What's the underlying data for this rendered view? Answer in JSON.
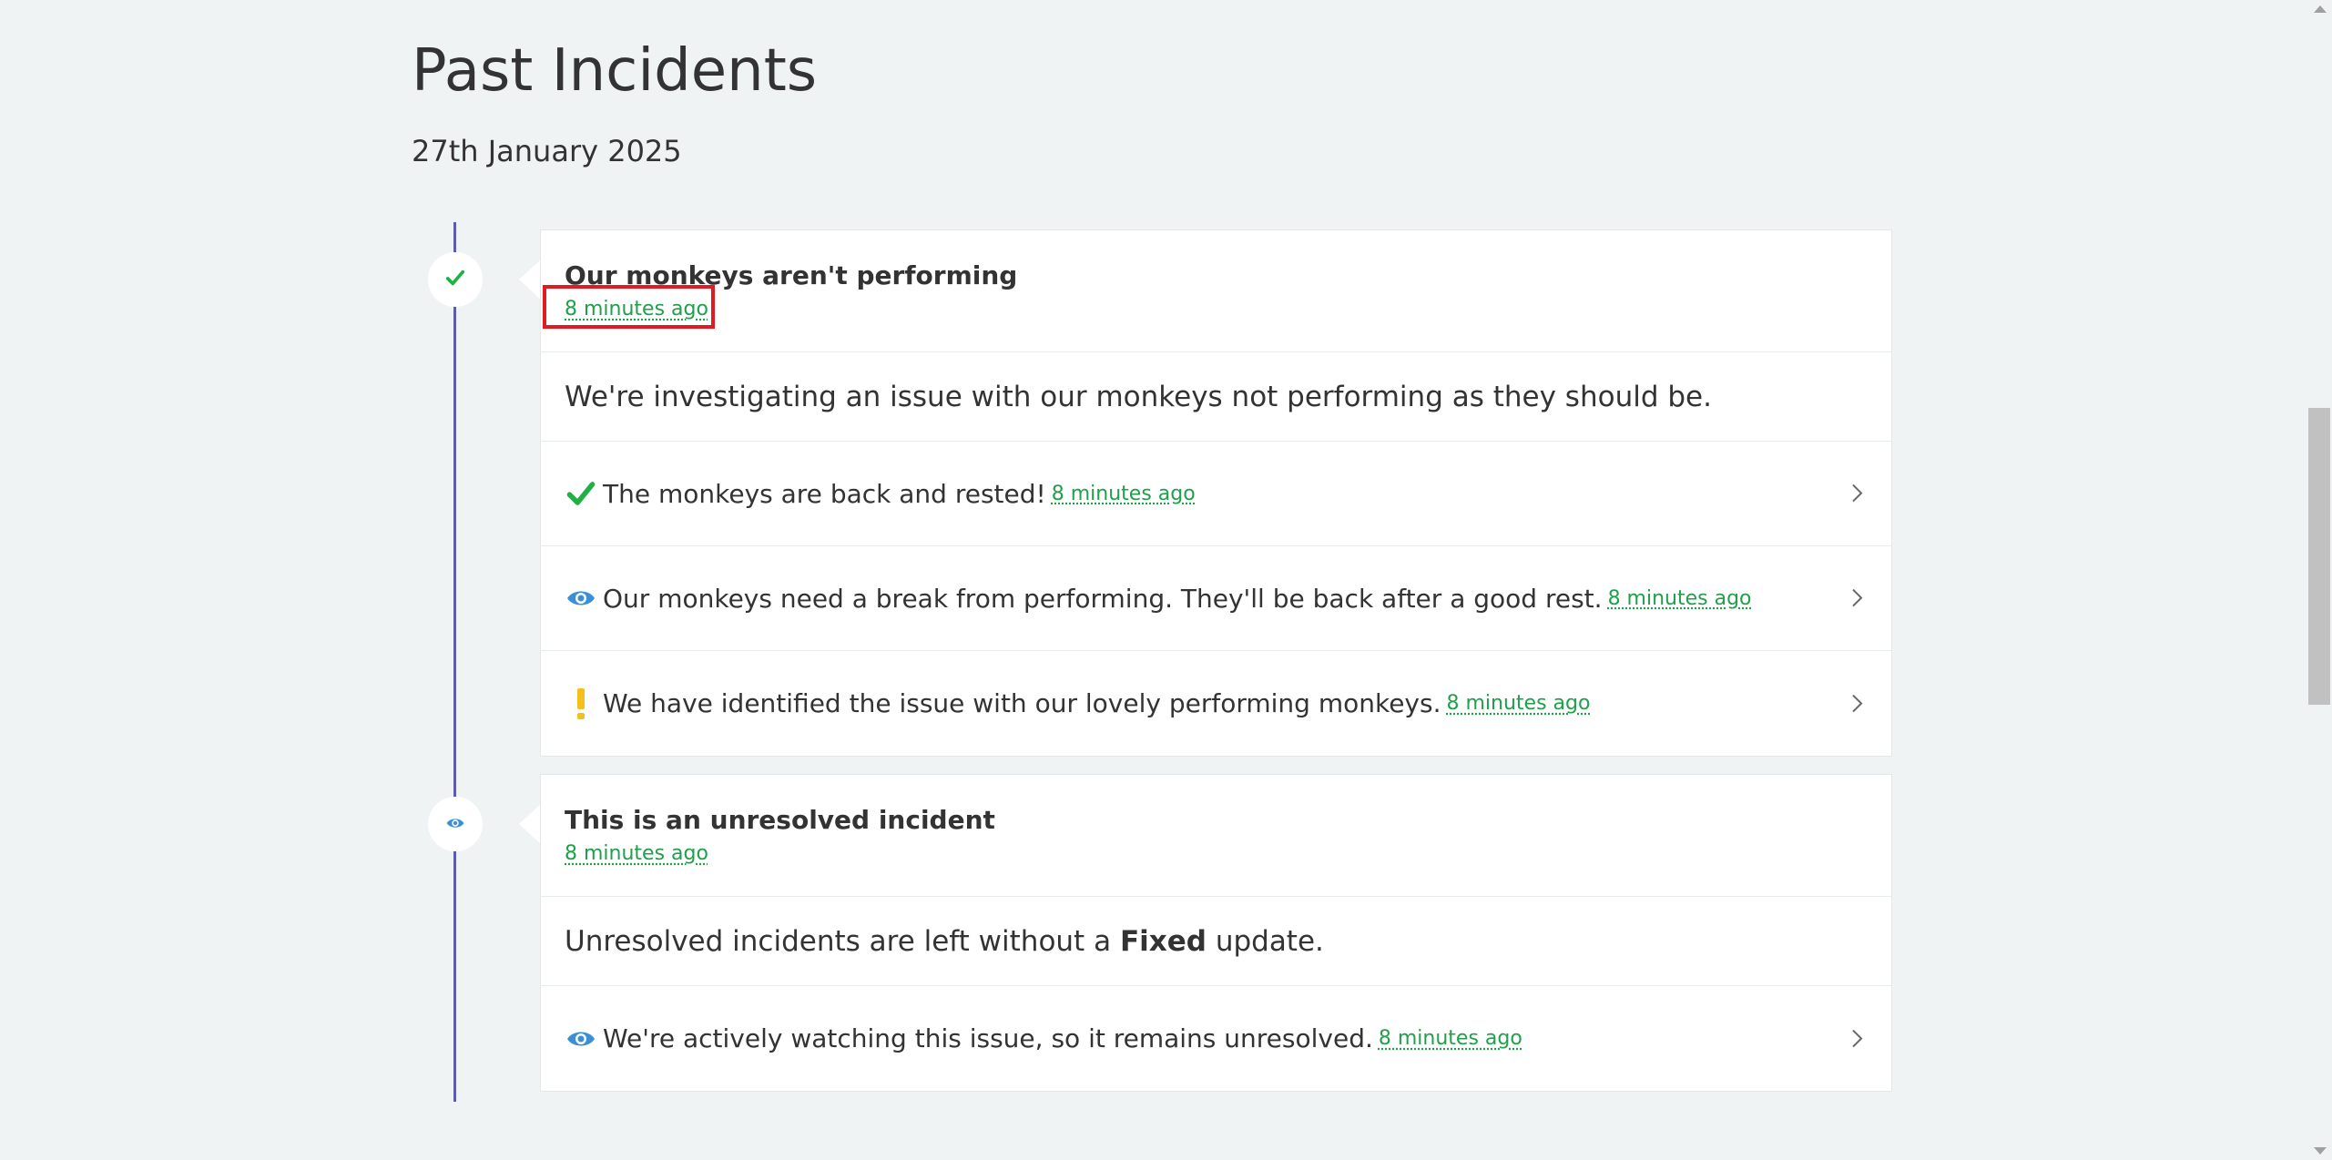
{
  "page": {
    "title": "Past Incidents",
    "date": "27th January 2025"
  },
  "colors": {
    "timeline": "#5b5bb0",
    "link_green": "#20a04b",
    "fixed_green": "#20b046",
    "watching_blue": "#3a8fd6",
    "identified_yellow": "#f4c01c",
    "highlight_red": "#e01b24"
  },
  "incidents": [
    {
      "status_icon": "check-icon",
      "title": "Our monkeys aren't performing",
      "timestamp": "8 minutes ago",
      "message": "We're investigating an issue with our monkeys not performing as they should be.",
      "updates": [
        {
          "icon": "check-icon",
          "text": "The monkeys are back and rested!",
          "timestamp": "8 minutes ago"
        },
        {
          "icon": "eye-icon",
          "text": "Our monkeys need a break from performing. They'll be back after a good rest.",
          "timestamp": "8 minutes ago"
        },
        {
          "icon": "exclamation-icon",
          "text": "We have identified the issue with our lovely performing monkeys.",
          "timestamp": "8 minutes ago"
        }
      ]
    },
    {
      "status_icon": "eye-icon",
      "title": "This is an unresolved incident",
      "timestamp": "8 minutes ago",
      "message_before": "Unresolved incidents are left without a",
      "message_bold": "Fixed",
      "message_after": "update.",
      "updates": [
        {
          "icon": "eye-icon",
          "text": "We're actively watching this issue, so it remains unresolved.",
          "timestamp": "8 minutes ago"
        }
      ]
    }
  ]
}
